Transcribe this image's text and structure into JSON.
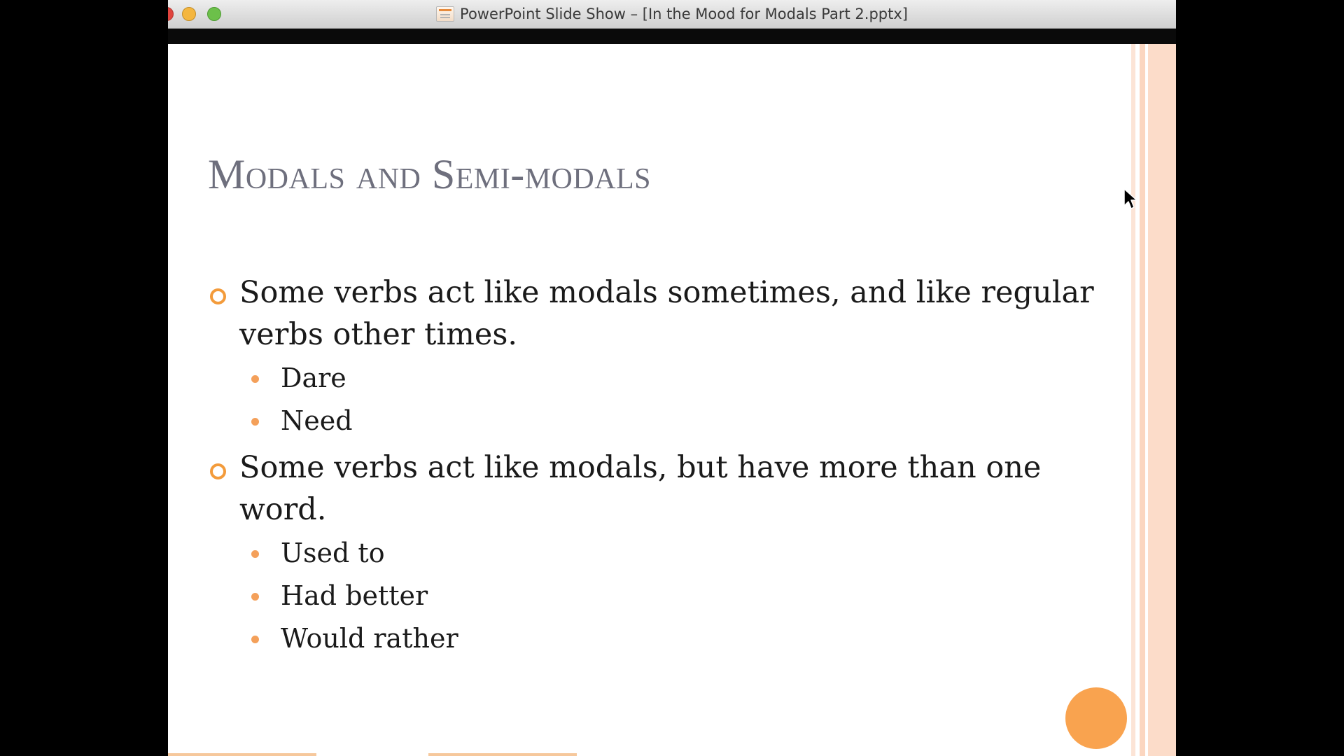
{
  "window": {
    "title": "PowerPoint Slide Show – [In the Mood for Modals Part 2.pptx]",
    "doc_icon": "powerpoint-document-icon"
  },
  "slide": {
    "title": "Modals and Semi-modals",
    "bullets": [
      {
        "text": "Some verbs act like modals sometimes, and like regular verbs other times.",
        "sub": [
          "Dare",
          "Need"
        ]
      },
      {
        "text": "Some verbs act like modals, but have more than one word.",
        "sub": [
          "Used to",
          "Had better",
          "Would rather"
        ]
      }
    ]
  },
  "colors": {
    "accent": "#f39b3b",
    "title": "#6e6f7d",
    "stripe": "#fcdcc9"
  }
}
